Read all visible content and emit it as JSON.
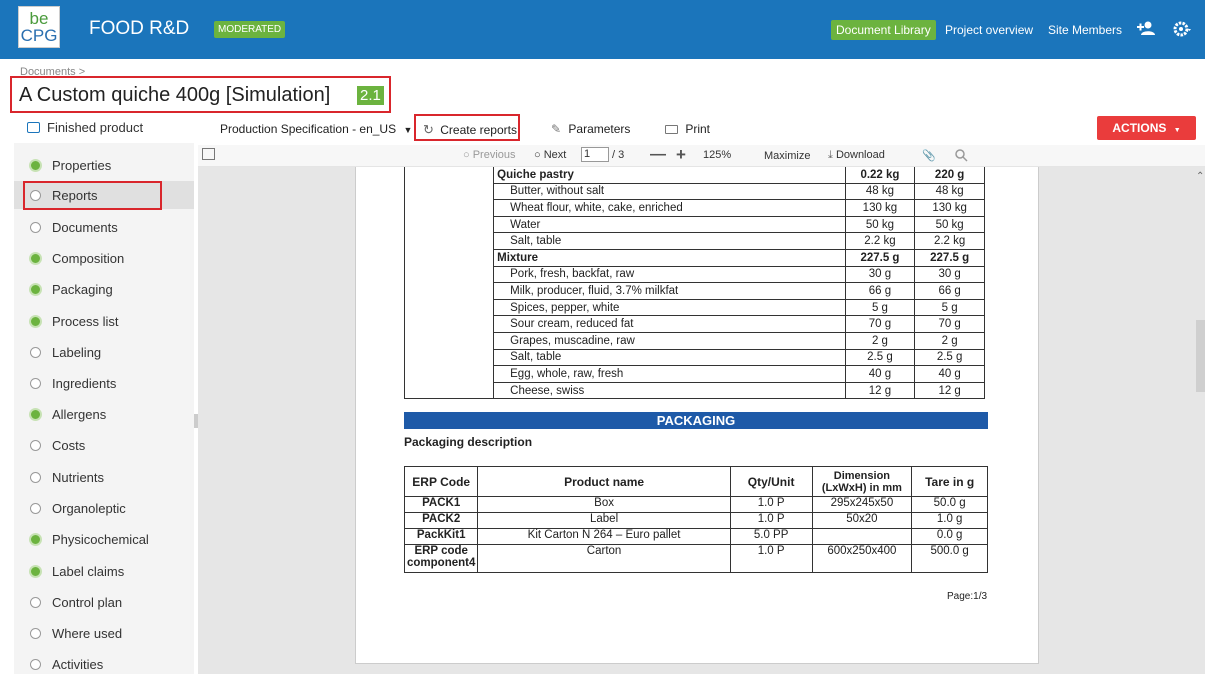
{
  "header": {
    "logo_line1": "be",
    "logo_line2": "CPG",
    "site_title": "FOOD R&D",
    "site_badge": "MODERATED",
    "nav": [
      "Document Library",
      "Project overview",
      "Site Members"
    ]
  },
  "breadcrumb": "Documents  >",
  "document": {
    "title": "A Custom quiche 400g [Simulation]",
    "version": "2.1"
  },
  "sidebar": {
    "heading": "Finished product",
    "items": [
      {
        "label": "Properties",
        "done": true
      },
      {
        "label": "Reports",
        "done": false
      },
      {
        "label": "Documents",
        "done": false
      },
      {
        "label": "Composition",
        "done": true
      },
      {
        "label": "Packaging",
        "done": true
      },
      {
        "label": "Process list",
        "done": true
      },
      {
        "label": "Labeling",
        "done": false
      },
      {
        "label": "Ingredients",
        "done": false
      },
      {
        "label": "Allergens",
        "done": true
      },
      {
        "label": "Costs",
        "done": false
      },
      {
        "label": "Nutrients",
        "done": false
      },
      {
        "label": "Organoleptic",
        "done": false
      },
      {
        "label": "Physicochemical",
        "done": true
      },
      {
        "label": "Label claims",
        "done": true
      },
      {
        "label": "Control plan",
        "done": false
      },
      {
        "label": "Where used",
        "done": false
      },
      {
        "label": "Activities",
        "done": false
      }
    ]
  },
  "toolbar": {
    "report_select": "Production Specification - en_US",
    "create_reports": "Create reports",
    "parameters": "Parameters",
    "print": "Print",
    "actions": "ACTIONS"
  },
  "viewer": {
    "previous": "Previous",
    "next": "Next",
    "page_current": "1",
    "page_total": "/ 3",
    "zoom": "125%",
    "maximize": "Maximize",
    "download": "Download"
  },
  "report": {
    "ingredients": [
      {
        "name": "Quiche pastry",
        "group": true,
        "q1": "0.22 kg",
        "q2": "220 g"
      },
      {
        "name": "Butter, without salt",
        "q1": "48 kg",
        "q2": "48 kg"
      },
      {
        "name": "Wheat flour, white, cake, enriched",
        "q1": "130 kg",
        "q2": "130 kg"
      },
      {
        "name": "Water",
        "q1": "50 kg",
        "q2": "50 kg"
      },
      {
        "name": "Salt, table",
        "q1": "2.2 kg",
        "q2": "2.2 kg"
      },
      {
        "name": "Mixture",
        "group": true,
        "q1": "227.5 g",
        "q2": "227.5 g"
      },
      {
        "name": "Pork, fresh, backfat, raw",
        "q1": "30 g",
        "q2": "30 g"
      },
      {
        "name": "Milk, producer, fluid, 3.7% milkfat",
        "q1": "66 g",
        "q2": "66 g"
      },
      {
        "name": "Spices, pepper, white",
        "q1": "5 g",
        "q2": "5 g"
      },
      {
        "name": "Sour cream, reduced fat",
        "q1": "70 g",
        "q2": "70 g"
      },
      {
        "name": "Grapes, muscadine, raw",
        "q1": "2 g",
        "q2": "2 g"
      },
      {
        "name": "Salt, table",
        "q1": "2.5 g",
        "q2": "2.5 g"
      },
      {
        "name": "Egg, whole, raw, fresh",
        "q1": "40 g",
        "q2": "40 g"
      },
      {
        "name": "Cheese, swiss",
        "q1": "12 g",
        "q2": "12 g"
      }
    ],
    "packaging_title": "PACKAGING",
    "packaging_description": "Packaging description",
    "packaging_headers": [
      "ERP Code",
      "Product name",
      "Qty/Unit",
      "Dimension (LxWxH) in mm",
      "Tare in g"
    ],
    "packaging_rows": [
      [
        "PACK1",
        "Box",
        "1.0 P",
        "295x245x50",
        "50.0 g"
      ],
      [
        "PACK2",
        "Label",
        "1.0 P",
        "50x20",
        "1.0 g"
      ],
      [
        "PackKit1",
        "Kit Carton N 264 – Euro pallet",
        "5.0 PP",
        "",
        "0.0 g"
      ],
      [
        "ERP code component4",
        "Carton",
        "1.0 P",
        "600x250x400",
        "500.0 g"
      ]
    ],
    "page_label": "Page:1/3"
  },
  "colors": {
    "brand_blue": "#1b75bb",
    "green": "#6cb33f",
    "actions_red": "#ea3c3c",
    "highlight_red": "#d9262c"
  }
}
